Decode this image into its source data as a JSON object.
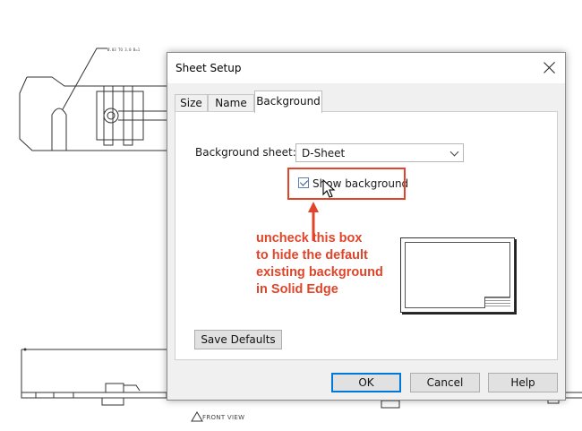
{
  "dialog": {
    "title": "Sheet Setup",
    "tabs": [
      {
        "label": "Size"
      },
      {
        "label": "Name"
      },
      {
        "label": "Background",
        "active": true
      }
    ],
    "background_sheet_label": "Background sheet:",
    "background_sheet_value": "D-Sheet",
    "show_background_label": "Show background",
    "show_background_checked": true,
    "buttons": {
      "save_defaults": "Save Defaults",
      "ok": "OK",
      "cancel": "Cancel",
      "help": "Help"
    }
  },
  "annotation": {
    "lines": [
      "uncheck this box",
      "to hide the default",
      "existing background",
      "in Solid Edge"
    ],
    "color": "#e0452a"
  },
  "drawing": {
    "view_label": "FRONT VIEW",
    "leader_note": "Ø.03 TO 3.0 B=1"
  },
  "icons": {
    "close": "close-icon",
    "dropdown": "chevron-down-icon",
    "cursor": "mouse-pointer-icon",
    "arrow": "arrow-up-icon"
  }
}
